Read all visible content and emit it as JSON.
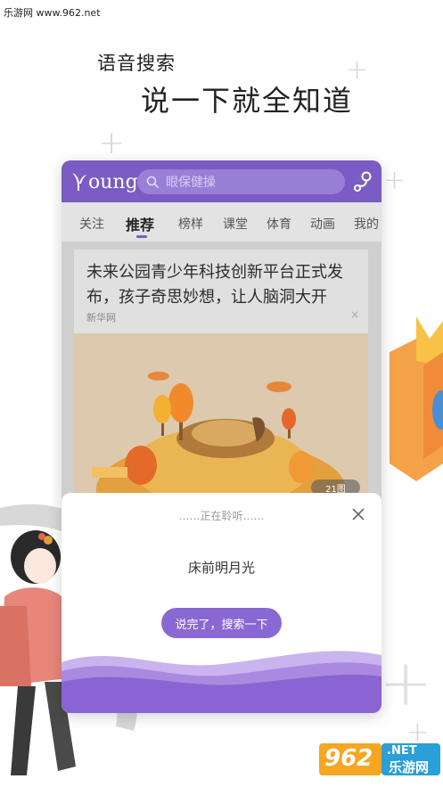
{
  "watermark_top": "乐游网 www.962.net",
  "hero": {
    "subtitle": "语音搜索",
    "title": "说一下就全知道"
  },
  "app": {
    "logo_text": "oung",
    "search_placeholder": "眼保健操",
    "accent_color": "#7a5cc4",
    "tabs": [
      {
        "label": "关注"
      },
      {
        "label": "推荐",
        "active": true
      },
      {
        "label": "榜样"
      },
      {
        "label": "课堂"
      },
      {
        "label": "体育"
      },
      {
        "label": "动画"
      },
      {
        "label": "我的"
      }
    ],
    "article": {
      "title": "未来公园青少年科技创新平台正式发布，孩子奇思妙想，让人脑洞大开",
      "source": "新华网",
      "close_glyph": "×",
      "image_count": "21图"
    }
  },
  "voice_modal": {
    "status": "……正在聆听……",
    "recognized_text": "床前明月光",
    "submit_label": "说完了，搜索一下"
  },
  "watermark_bottom": {
    "brand": "962",
    "suffix": ".NET",
    "cn": "乐游网"
  }
}
